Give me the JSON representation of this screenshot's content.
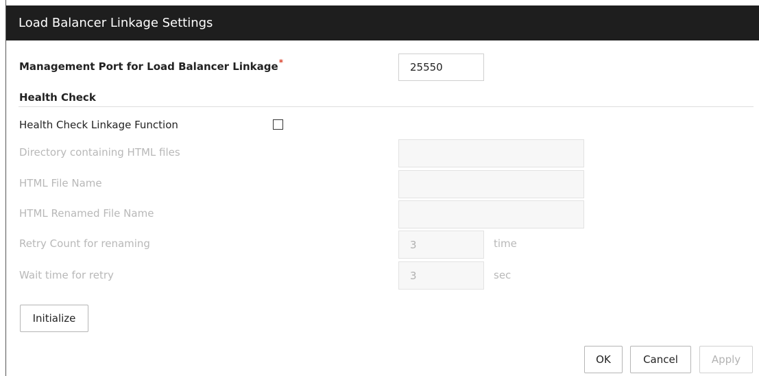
{
  "title": "Load Balancer Linkage Settings",
  "management_port": {
    "label": "Management Port for Load Balancer Linkage",
    "required_mark": "*",
    "value": "25550"
  },
  "health_check": {
    "section_title": "Health Check",
    "linkage_function_label": "Health Check Linkage Function",
    "linkage_function_checked": false,
    "directory_label": "Directory containing HTML files",
    "directory_value": "",
    "html_file_label": "HTML File Name",
    "html_file_value": "",
    "renamed_file_label": "HTML Renamed File Name",
    "renamed_file_value": "",
    "retry_count_label": "Retry Count for renaming",
    "retry_count_value": "3",
    "retry_count_unit": "time",
    "wait_time_label": "Wait time for retry",
    "wait_time_value": "3",
    "wait_time_unit": "sec"
  },
  "buttons": {
    "initialize": "Initialize",
    "ok": "OK",
    "cancel": "Cancel",
    "apply": "Apply"
  }
}
